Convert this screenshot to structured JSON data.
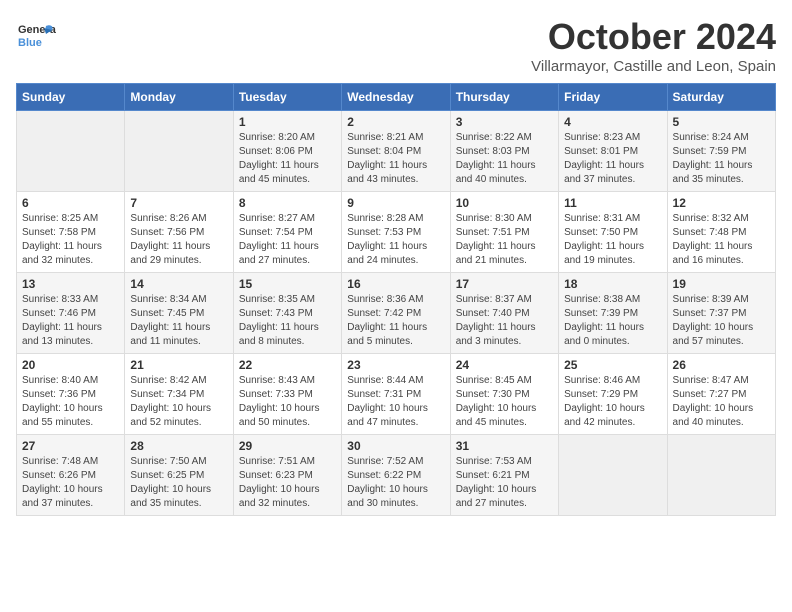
{
  "logo": {
    "general": "General",
    "blue": "Blue"
  },
  "title": "October 2024",
  "subtitle": "Villarmayor, Castille and Leon, Spain",
  "days_header": [
    "Sunday",
    "Monday",
    "Tuesday",
    "Wednesday",
    "Thursday",
    "Friday",
    "Saturday"
  ],
  "weeks": [
    [
      {
        "day": "",
        "info": ""
      },
      {
        "day": "",
        "info": ""
      },
      {
        "day": "1",
        "info": "Sunrise: 8:20 AM\nSunset: 8:06 PM\nDaylight: 11 hours and 45 minutes."
      },
      {
        "day": "2",
        "info": "Sunrise: 8:21 AM\nSunset: 8:04 PM\nDaylight: 11 hours and 43 minutes."
      },
      {
        "day": "3",
        "info": "Sunrise: 8:22 AM\nSunset: 8:03 PM\nDaylight: 11 hours and 40 minutes."
      },
      {
        "day": "4",
        "info": "Sunrise: 8:23 AM\nSunset: 8:01 PM\nDaylight: 11 hours and 37 minutes."
      },
      {
        "day": "5",
        "info": "Sunrise: 8:24 AM\nSunset: 7:59 PM\nDaylight: 11 hours and 35 minutes."
      }
    ],
    [
      {
        "day": "6",
        "info": "Sunrise: 8:25 AM\nSunset: 7:58 PM\nDaylight: 11 hours and 32 minutes."
      },
      {
        "day": "7",
        "info": "Sunrise: 8:26 AM\nSunset: 7:56 PM\nDaylight: 11 hours and 29 minutes."
      },
      {
        "day": "8",
        "info": "Sunrise: 8:27 AM\nSunset: 7:54 PM\nDaylight: 11 hours and 27 minutes."
      },
      {
        "day": "9",
        "info": "Sunrise: 8:28 AM\nSunset: 7:53 PM\nDaylight: 11 hours and 24 minutes."
      },
      {
        "day": "10",
        "info": "Sunrise: 8:30 AM\nSunset: 7:51 PM\nDaylight: 11 hours and 21 minutes."
      },
      {
        "day": "11",
        "info": "Sunrise: 8:31 AM\nSunset: 7:50 PM\nDaylight: 11 hours and 19 minutes."
      },
      {
        "day": "12",
        "info": "Sunrise: 8:32 AM\nSunset: 7:48 PM\nDaylight: 11 hours and 16 minutes."
      }
    ],
    [
      {
        "day": "13",
        "info": "Sunrise: 8:33 AM\nSunset: 7:46 PM\nDaylight: 11 hours and 13 minutes."
      },
      {
        "day": "14",
        "info": "Sunrise: 8:34 AM\nSunset: 7:45 PM\nDaylight: 11 hours and 11 minutes."
      },
      {
        "day": "15",
        "info": "Sunrise: 8:35 AM\nSunset: 7:43 PM\nDaylight: 11 hours and 8 minutes."
      },
      {
        "day": "16",
        "info": "Sunrise: 8:36 AM\nSunset: 7:42 PM\nDaylight: 11 hours and 5 minutes."
      },
      {
        "day": "17",
        "info": "Sunrise: 8:37 AM\nSunset: 7:40 PM\nDaylight: 11 hours and 3 minutes."
      },
      {
        "day": "18",
        "info": "Sunrise: 8:38 AM\nSunset: 7:39 PM\nDaylight: 11 hours and 0 minutes."
      },
      {
        "day": "19",
        "info": "Sunrise: 8:39 AM\nSunset: 7:37 PM\nDaylight: 10 hours and 57 minutes."
      }
    ],
    [
      {
        "day": "20",
        "info": "Sunrise: 8:40 AM\nSunset: 7:36 PM\nDaylight: 10 hours and 55 minutes."
      },
      {
        "day": "21",
        "info": "Sunrise: 8:42 AM\nSunset: 7:34 PM\nDaylight: 10 hours and 52 minutes."
      },
      {
        "day": "22",
        "info": "Sunrise: 8:43 AM\nSunset: 7:33 PM\nDaylight: 10 hours and 50 minutes."
      },
      {
        "day": "23",
        "info": "Sunrise: 8:44 AM\nSunset: 7:31 PM\nDaylight: 10 hours and 47 minutes."
      },
      {
        "day": "24",
        "info": "Sunrise: 8:45 AM\nSunset: 7:30 PM\nDaylight: 10 hours and 45 minutes."
      },
      {
        "day": "25",
        "info": "Sunrise: 8:46 AM\nSunset: 7:29 PM\nDaylight: 10 hours and 42 minutes."
      },
      {
        "day": "26",
        "info": "Sunrise: 8:47 AM\nSunset: 7:27 PM\nDaylight: 10 hours and 40 minutes."
      }
    ],
    [
      {
        "day": "27",
        "info": "Sunrise: 7:48 AM\nSunset: 6:26 PM\nDaylight: 10 hours and 37 minutes."
      },
      {
        "day": "28",
        "info": "Sunrise: 7:50 AM\nSunset: 6:25 PM\nDaylight: 10 hours and 35 minutes."
      },
      {
        "day": "29",
        "info": "Sunrise: 7:51 AM\nSunset: 6:23 PM\nDaylight: 10 hours and 32 minutes."
      },
      {
        "day": "30",
        "info": "Sunrise: 7:52 AM\nSunset: 6:22 PM\nDaylight: 10 hours and 30 minutes."
      },
      {
        "day": "31",
        "info": "Sunrise: 7:53 AM\nSunset: 6:21 PM\nDaylight: 10 hours and 27 minutes."
      },
      {
        "day": "",
        "info": ""
      },
      {
        "day": "",
        "info": ""
      }
    ]
  ]
}
